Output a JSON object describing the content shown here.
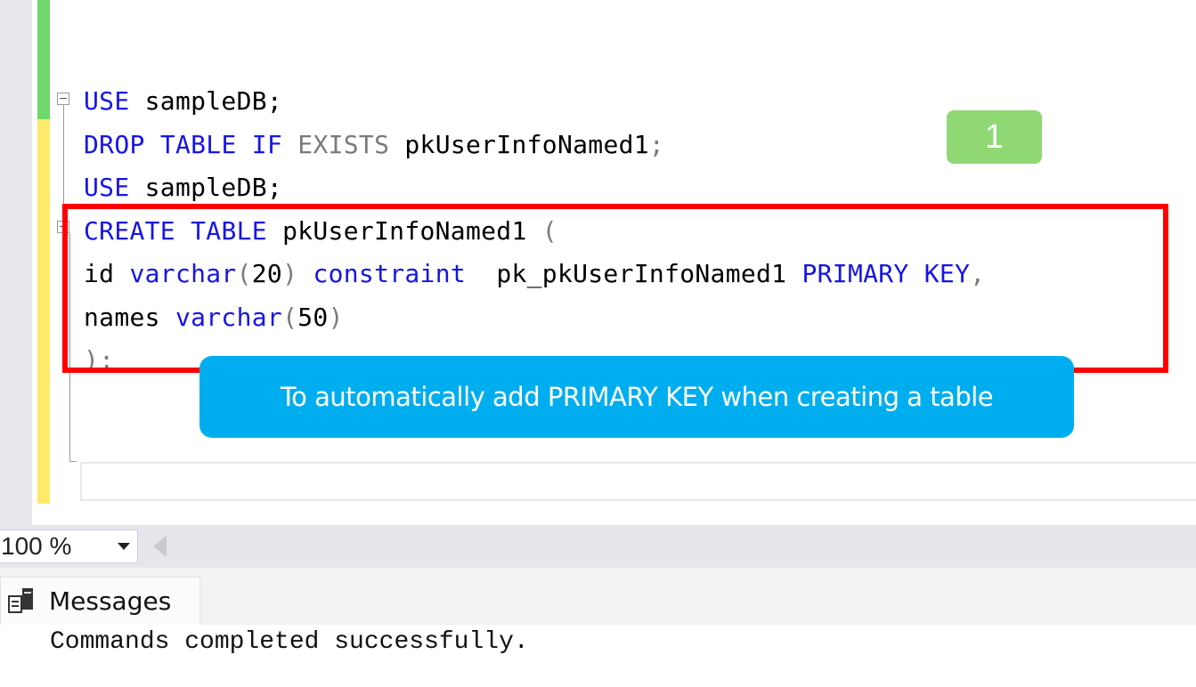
{
  "editor": {
    "lines": [
      [
        {
          "t": "USE",
          "c": "kw"
        },
        {
          "t": " sampleDB;",
          "c": "ident"
        }
      ],
      [
        {
          "t": "DROP",
          "c": "kw"
        },
        {
          "t": " ",
          "c": "ident"
        },
        {
          "t": "TABLE",
          "c": "kw"
        },
        {
          "t": " ",
          "c": "ident"
        },
        {
          "t": "IF",
          "c": "kw"
        },
        {
          "t": " ",
          "c": "ident"
        },
        {
          "t": "EXISTS",
          "c": "gray"
        },
        {
          "t": " pkUserInfoNamed1",
          "c": "ident"
        },
        {
          "t": ";",
          "c": "gray"
        }
      ],
      [
        {
          "t": "USE",
          "c": "kw"
        },
        {
          "t": " sampleDB;",
          "c": "ident"
        }
      ],
      [
        {
          "t": "CREATE",
          "c": "kw"
        },
        {
          "t": " ",
          "c": "ident"
        },
        {
          "t": "TABLE",
          "c": "kw"
        },
        {
          "t": " pkUserInfoNamed1 ",
          "c": "ident"
        },
        {
          "t": "(",
          "c": "gray"
        }
      ],
      [
        {
          "t": "id ",
          "c": "ident"
        },
        {
          "t": "varchar",
          "c": "kw"
        },
        {
          "t": "(",
          "c": "gray"
        },
        {
          "t": "20",
          "c": "ident"
        },
        {
          "t": ")",
          "c": "gray"
        },
        {
          "t": " ",
          "c": "ident"
        },
        {
          "t": "constraint",
          "c": "kw"
        },
        {
          "t": "  pk_pkUserInfoNamed1 ",
          "c": "ident"
        },
        {
          "t": "PRIMARY",
          "c": "kw"
        },
        {
          "t": " ",
          "c": "ident"
        },
        {
          "t": "KEY",
          "c": "kw"
        },
        {
          "t": ",",
          "c": "gray"
        }
      ],
      [
        {
          "t": "names ",
          "c": "ident"
        },
        {
          "t": "varchar",
          "c": "kw"
        },
        {
          "t": "(",
          "c": "gray"
        },
        {
          "t": "50",
          "c": "ident"
        },
        {
          "t": ")",
          "c": "gray"
        }
      ],
      [
        {
          "t": ");",
          "c": "gray"
        }
      ]
    ]
  },
  "annotations": {
    "step_badge": "1",
    "callout_text": "To automatically add PRIMARY KEY when creating a table",
    "colors": {
      "badge": "#8fd874",
      "callout": "#00aeef",
      "highlight_box": "#ff0000"
    }
  },
  "toolbar": {
    "zoom_value": "100 %"
  },
  "results": {
    "tab_label": "Messages",
    "message": "Commands completed successfully."
  }
}
